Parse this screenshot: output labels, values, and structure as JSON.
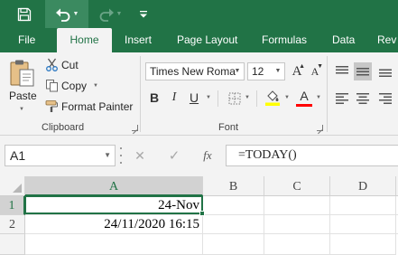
{
  "quick_access": {
    "save_icon": "save-icon",
    "undo_icon": "undo-icon",
    "redo_icon": "redo-icon"
  },
  "tabs": [
    {
      "label": "File",
      "active": false
    },
    {
      "label": "Home",
      "active": true
    },
    {
      "label": "Insert",
      "active": false
    },
    {
      "label": "Page Layout",
      "active": false
    },
    {
      "label": "Formulas",
      "active": false
    },
    {
      "label": "Data",
      "active": false
    },
    {
      "label": "Rev",
      "active": false
    }
  ],
  "clipboard": {
    "paste_label": "Paste",
    "cut_label": "Cut",
    "copy_label": "Copy",
    "format_painter_label": "Format Painter",
    "group_label": "Clipboard"
  },
  "font": {
    "family": "Times New Roma",
    "size": "12",
    "group_label": "Font",
    "bold_label": "B",
    "italic_label": "I",
    "underline_label": "U",
    "grow_label": "A",
    "shrink_label": "A",
    "color_label": "A",
    "highlight_color": "#ffff00",
    "font_color": "#ff0000"
  },
  "formula_bar": {
    "name_box": "A1",
    "cancel_glyph": "✕",
    "enter_glyph": "✓",
    "fx_label": "fx",
    "formula": "=TODAY()"
  },
  "grid": {
    "columns": [
      "A",
      "B",
      "C",
      "D"
    ],
    "rows": [
      "1",
      "2"
    ],
    "cells": {
      "A1": "24-Nov",
      "A2": "24/11/2020 16:15"
    },
    "selected_cell": "A1"
  },
  "colors": {
    "brand": "#217346",
    "ribbon_bg": "#f3f3f3"
  }
}
